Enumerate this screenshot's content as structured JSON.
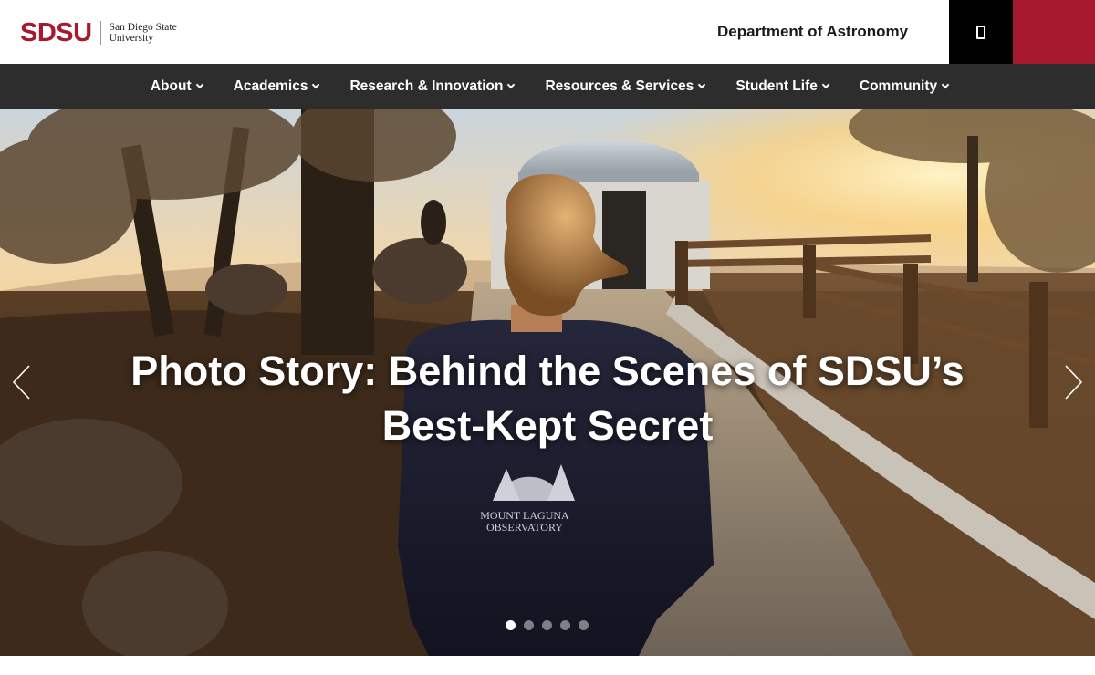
{
  "header": {
    "logo_mark": "SDSU",
    "logo_line1": "San Diego State",
    "logo_line2": "University",
    "department": "Department of Astronomy",
    "search_icon": "search-icon"
  },
  "nav": {
    "items": [
      {
        "label": "About"
      },
      {
        "label": "Academics"
      },
      {
        "label": "Research & Innovation"
      },
      {
        "label": "Resources & Services"
      },
      {
        "label": "Student Life"
      },
      {
        "label": "Community"
      }
    ]
  },
  "hero": {
    "title_line1": "Photo Story: Behind the Scenes of SDSU’s",
    "title_line2": "Best-Kept Secret",
    "sweatshirt_line1": "MOUNT LAGUNA",
    "sweatshirt_line2": "OBSERVATORY",
    "slides_total": 5,
    "active_slide": 1
  },
  "colors": {
    "brand_red": "#a6192e",
    "nav_bg": "#2d2d2d",
    "black": "#000000"
  }
}
